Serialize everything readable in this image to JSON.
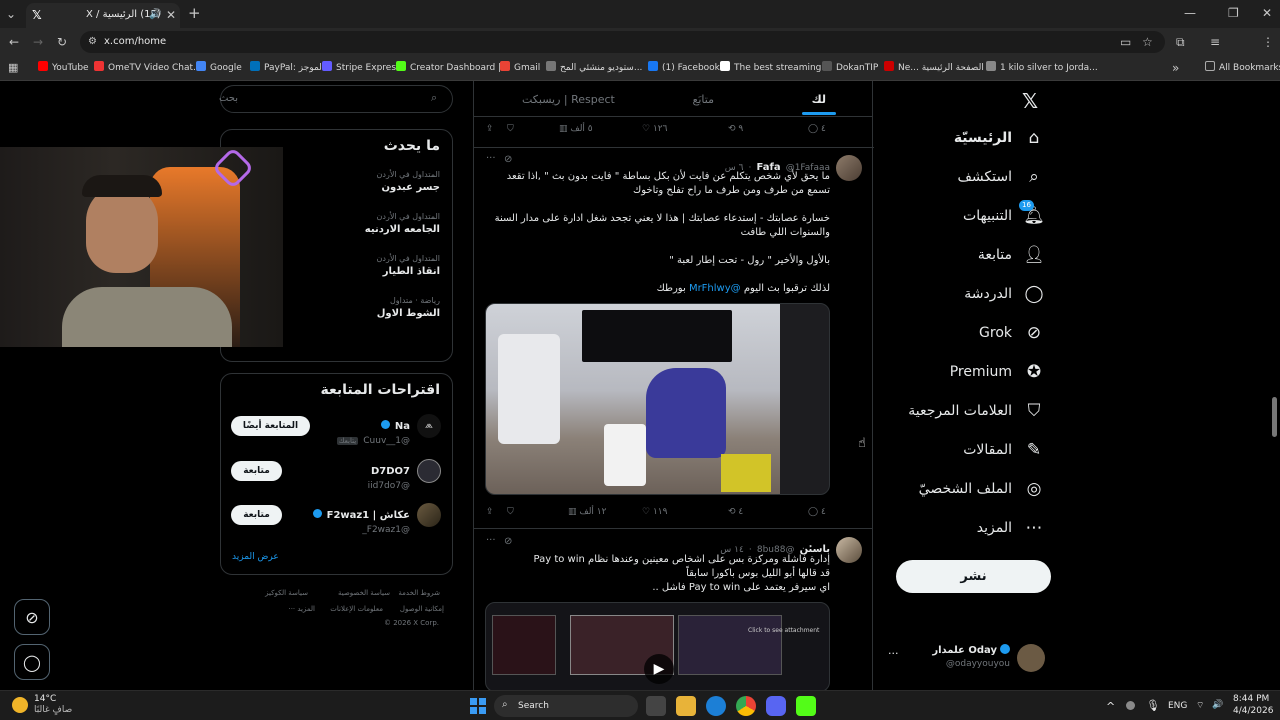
{
  "browser": {
    "tab_title": "(15) الرئيسية / X",
    "url": "x.com/home",
    "bookmarks": [
      {
        "label": "YouTube",
        "color": "#ff0000"
      },
      {
        "label": "OmeTV Video Chat...",
        "color": "#e33"
      },
      {
        "label": "Google",
        "color": "#4285f4"
      },
      {
        "label": "PayPal: الموجز",
        "color": "#0070ba"
      },
      {
        "label": "Stripe Express",
        "color": "#635bff"
      },
      {
        "label": "Creator Dashboard |...",
        "color": "#53fc18"
      },
      {
        "label": "Gmail",
        "color": "#ea4335"
      },
      {
        "label": "ستوديو منشئي المح...",
        "color": "#777"
      },
      {
        "label": "(1) Facebook",
        "color": "#1877f2"
      },
      {
        "label": "The best streaming...",
        "color": "#fff"
      },
      {
        "label": "DokanTIP",
        "color": "#555"
      },
      {
        "label": "Ne... الصفحة الرئيسية",
        "color": "#c00"
      },
      {
        "label": "1 kilo silver to Jorda...",
        "color": "#888"
      }
    ],
    "all_bookmarks": "All Bookmarks"
  },
  "nav": {
    "items": [
      {
        "label": "الرئيسيّة",
        "icon": "home-icon"
      },
      {
        "label": "استكشف",
        "icon": "search-icon"
      },
      {
        "label": "التنبيهات",
        "icon": "bell-icon",
        "badge": "16"
      },
      {
        "label": "متابعة",
        "icon": "add-user-icon"
      },
      {
        "label": "الدردشة",
        "icon": "chat-icon"
      },
      {
        "label": "Grok",
        "icon": "grok-icon"
      },
      {
        "label": "Premium",
        "icon": "premium-icon"
      },
      {
        "label": "العلامات المرجعية",
        "icon": "bookmark-icon"
      },
      {
        "label": "المقالات",
        "icon": "article-icon"
      },
      {
        "label": "الملف الشخصيّ",
        "icon": "profile-icon"
      },
      {
        "label": "المزيد",
        "icon": "more-icon"
      }
    ],
    "post_label": "نشر",
    "account": {
      "name": "Oday علمدار",
      "handle": "@odayyouyou"
    }
  },
  "feed": {
    "tabs": [
      "لك",
      "متابَع",
      "ريسبكت | Respect"
    ],
    "top_actions": {
      "replies": "٤",
      "reposts": "٩",
      "likes": "١٢٦",
      "views": "٥ ألف"
    },
    "tweet1": {
      "name": "Fafa",
      "handle": "@1Fafaaa",
      "time": "٦ س",
      "p1": "ما يحق لأي شخص يتكلم عن فايت لأن بكل بساطة \" فايت بدون بث \" ,اذا تقعد تسمع من طرف ومن طرف ما راح تفلح وتاخوك",
      "p2": "خسارة عصابتك - إستدعاء عصابتك | هذا لا يعني تجحد شغل ادارة على مدار السنة والسنوات اللي طافت",
      "p3": "بالأول والأخير \" رول - تحت إطار لعبة \"",
      "p4_pre": "لذلك ترقبوا بث اليوم",
      "p4_link": "@MrFhlwy",
      "p4_post": "بورطك",
      "actions": {
        "replies": "٤",
        "reposts": "٤",
        "likes": "١١٩",
        "views": "١٢ ألف"
      }
    },
    "tweet2": {
      "name": "باسىٔن",
      "handle": "@8bu88",
      "time": "١٤ س",
      "l1": "إدارة فاشلة ومركزة بس على اشخاص معينين وعندها نظام Pay to win",
      "l2": "قد قالها أبو الليل بوس باكورا سابقاً",
      "l3": "اي سيرفر يعتمد على Pay to win فاشل ..",
      "video_overlay": "Click to see attachment"
    }
  },
  "sidebar": {
    "search_placeholder": "بحث",
    "trends_title": "ما يحدث",
    "trends": [
      {
        "category": "المتداول في الأردن",
        "name": "جسر عبدون"
      },
      {
        "category": "المتداول في الأردن",
        "name": "الجامعه الاردنيه"
      },
      {
        "category": "المتداول في الأردن",
        "name": "انقاذ الطيار"
      },
      {
        "category": "رياضة · متداول",
        "name": "الشوط الاول"
      }
    ],
    "who_title": "اقتراحات المتابعة",
    "who": [
      {
        "name": "Na",
        "handle": "@Cuuv__1",
        "button": "المتابعة أيضًا",
        "tag": "يتابعك"
      },
      {
        "name": "D7DO7",
        "handle": "@iid7do7",
        "button": "متابعة"
      },
      {
        "name": "عكاش | F2waz1",
        "handle": "@F2waz1_",
        "button": "متابعة"
      }
    ],
    "show_more": "عرض المزيد",
    "footer": [
      "شروط الخدمة",
      "سياسة الخصوصية",
      "سياسة الكوكيز",
      "إمكانية الوصول",
      "معلومات الإعلانات",
      "المزيد ···",
      "© 2026 X Corp."
    ]
  },
  "taskbar": {
    "weather_temp": "14°C",
    "weather_desc": "صافٍ غالبًا",
    "search": "Search",
    "lang": "ENG",
    "time": "8:44 PM",
    "date": "4/4/2026"
  }
}
